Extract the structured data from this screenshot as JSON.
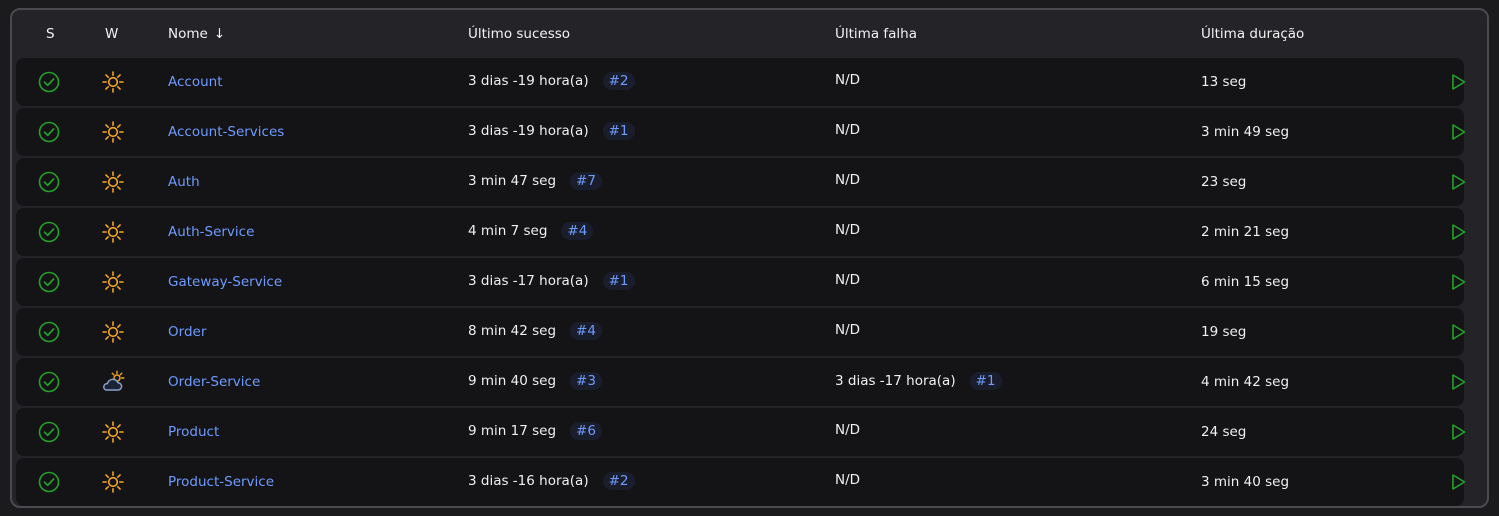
{
  "columns": {
    "s": "S",
    "w": "W",
    "name": "Nome",
    "sort_indicator": "↓",
    "last_success": "Último sucesso",
    "last_failure": "Última falha",
    "last_duration": "Última duração"
  },
  "colors": {
    "link": "#6d9bff",
    "success": "#23a228",
    "sun": "#f5a623",
    "cloud": "#8aa2c8"
  },
  "jobs": [
    {
      "status": "success",
      "weather": "sunny-icon",
      "name": "Account",
      "last_success": "3 dias -19 hora(a)",
      "last_success_build": "#2",
      "last_failure": "N/D",
      "last_failure_build": "",
      "duration": "13 seg"
    },
    {
      "status": "success",
      "weather": "sunny-icon",
      "name": "Account-Services",
      "last_success": "3 dias -19 hora(a)",
      "last_success_build": "#1",
      "last_failure": "N/D",
      "last_failure_build": "",
      "duration": "3 min 49 seg"
    },
    {
      "status": "success",
      "weather": "sunny-icon",
      "name": "Auth",
      "last_success": "3 min 47 seg",
      "last_success_build": "#7",
      "last_failure": "N/D",
      "last_failure_build": "",
      "duration": "23 seg"
    },
    {
      "status": "success",
      "weather": "sunny-icon",
      "name": "Auth-Service",
      "last_success": "4 min 7 seg",
      "last_success_build": "#4",
      "last_failure": "N/D",
      "last_failure_build": "",
      "duration": "2 min 21 seg"
    },
    {
      "status": "success",
      "weather": "sunny-icon",
      "name": "Gateway-Service",
      "last_success": "3 dias -17 hora(a)",
      "last_success_build": "#1",
      "last_failure": "N/D",
      "last_failure_build": "",
      "duration": "6 min 15 seg"
    },
    {
      "status": "success",
      "weather": "sunny-icon",
      "name": "Order",
      "last_success": "8 min 42 seg",
      "last_success_build": "#4",
      "last_failure": "N/D",
      "last_failure_build": "",
      "duration": "19 seg"
    },
    {
      "status": "success",
      "weather": "partly-cloudy-icon",
      "name": "Order-Service",
      "last_success": "9 min 40 seg",
      "last_success_build": "#3",
      "last_failure": "3 dias -17 hora(a)",
      "last_failure_build": "#1",
      "duration": "4 min 42 seg"
    },
    {
      "status": "success",
      "weather": "sunny-icon",
      "name": "Product",
      "last_success": "9 min 17 seg",
      "last_success_build": "#6",
      "last_failure": "N/D",
      "last_failure_build": "",
      "duration": "24 seg"
    },
    {
      "status": "success",
      "weather": "sunny-icon",
      "name": "Product-Service",
      "last_success": "3 dias -16 hora(a)",
      "last_success_build": "#2",
      "last_failure": "N/D",
      "last_failure_build": "",
      "duration": "3 min 40 seg"
    }
  ]
}
